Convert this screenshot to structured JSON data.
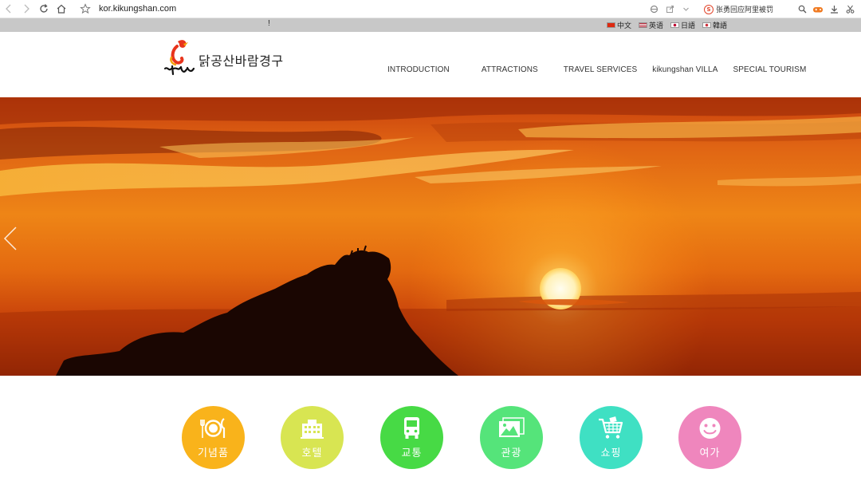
{
  "browser": {
    "url": "kor.kikungshan.com",
    "search_text": "张勇回应阿里被罚",
    "search_badge": "S"
  },
  "top_strip": {
    "notice": "!",
    "languages": [
      {
        "label": "中文",
        "flag": "cn-flag-icon"
      },
      {
        "label": "英语",
        "flag": "us-flag-icon"
      },
      {
        "label": "日語",
        "flag": "jp-flag-icon"
      },
      {
        "label": "韓語",
        "flag": "kr-flag-icon"
      }
    ]
  },
  "header": {
    "logo_text": "닭공산바람경구",
    "nav": [
      "INTRODUCTION",
      "ATTRACTIONS",
      "TRAVEL SERVICES",
      "kikungshan VILLA",
      "SPECIAL TOURISM"
    ]
  },
  "categories": [
    {
      "label": "기념품",
      "color": "#f9b31b",
      "icon": "dining-icon"
    },
    {
      "label": "호텔",
      "color": "#d8e552",
      "icon": "hotel-icon"
    },
    {
      "label": "교통",
      "color": "#47da45",
      "icon": "bus-icon"
    },
    {
      "label": "관광",
      "color": "#55e47a",
      "icon": "landscape-photo-icon"
    },
    {
      "label": "쇼핑",
      "color": "#3fe0c3",
      "icon": "shopping-cart-icon"
    },
    {
      "label": "여가",
      "color": "#ef86bd",
      "icon": "smiley-icon"
    }
  ],
  "colors": {
    "strip": "#c8c8c8",
    "sky_top": "#e85a10",
    "sky_mid": "#f28a14",
    "sun": "#fff7d6"
  }
}
